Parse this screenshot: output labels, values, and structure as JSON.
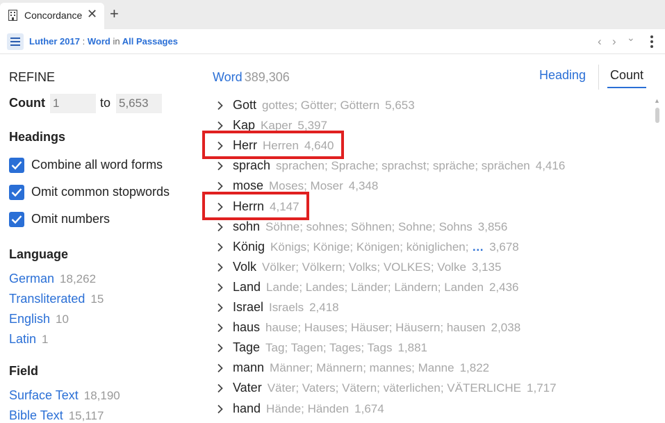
{
  "tab": {
    "title": "Concordance",
    "close_glyph": "✕",
    "add_glyph": "+",
    "icon": "building-icon"
  },
  "toolbar": {
    "resource": "Luther 2017",
    "separator": ":",
    "field": "Word",
    "in_word": "in",
    "scope": "All Passages",
    "nav_back": "‹",
    "nav_forward": "›",
    "nav_dropdown": "⌄"
  },
  "refine": {
    "title": "REFINE",
    "count_label": "Count",
    "count_min_placeholder": "1",
    "count_to": "to",
    "count_max_placeholder": "5,653"
  },
  "headings": {
    "title": "Headings",
    "options": [
      {
        "label": "Combine all word forms",
        "checked": true
      },
      {
        "label": "Omit common stopwords",
        "checked": true
      },
      {
        "label": "Omit numbers",
        "checked": true
      }
    ]
  },
  "language": {
    "title": "Language",
    "items": [
      {
        "name": "German",
        "count": "18,262"
      },
      {
        "name": "Transliterated",
        "count": "15"
      },
      {
        "name": "English",
        "count": "10"
      },
      {
        "name": "Latin",
        "count": "1"
      }
    ]
  },
  "field": {
    "title": "Field",
    "items": [
      {
        "name": "Surface Text",
        "count": "18,190"
      },
      {
        "name": "Bible Text",
        "count": "15,117"
      }
    ]
  },
  "results": {
    "label": "Word",
    "total": "389,306",
    "view_tabs": {
      "heading": "Heading",
      "count": "Count",
      "active": "count"
    },
    "rows": [
      {
        "word": "Gott",
        "forms": "gottes; Götter; Göttern",
        "more": "",
        "count": "5,653",
        "highlighted": false
      },
      {
        "word": "Kap",
        "forms": "Kaper",
        "more": "",
        "count": "5,397",
        "highlighted": false
      },
      {
        "word": "Herr",
        "forms": "Herren",
        "more": "",
        "count": "4,640",
        "highlighted": true
      },
      {
        "word": "sprach",
        "forms": "sprachen; Sprache; sprachst; spräche; sprächen",
        "more": "",
        "count": "4,416",
        "highlighted": false
      },
      {
        "word": "mose",
        "forms": "Moses; Moser",
        "more": "",
        "count": "4,348",
        "highlighted": false
      },
      {
        "word": "Herrn",
        "forms": "",
        "more": "",
        "count": "4,147",
        "highlighted": true
      },
      {
        "word": "sohn",
        "forms": "Söhne; sohnes; Söhnen; Sohne; Sohns",
        "more": "",
        "count": "3,856",
        "highlighted": false
      },
      {
        "word": "König",
        "forms": "Königs; Könige; Königen; königlichen;",
        "more": "…",
        "count": "3,678",
        "highlighted": false
      },
      {
        "word": "Volk",
        "forms": "Völker; Völkern; Volks; VOLKES; Volke",
        "more": "",
        "count": "3,135",
        "highlighted": false
      },
      {
        "word": "Land",
        "forms": "Lande; Landes; Länder; Ländern; Landen",
        "more": "",
        "count": "2,436",
        "highlighted": false
      },
      {
        "word": "Israel",
        "forms": "Israels",
        "more": "",
        "count": "2,418",
        "highlighted": false
      },
      {
        "word": "haus",
        "forms": "hause; Hauses; Häuser; Häusern; hausen",
        "more": "",
        "count": "2,038",
        "highlighted": false
      },
      {
        "word": "Tage",
        "forms": "Tag; Tagen; Tages; Tags",
        "more": "",
        "count": "1,881",
        "highlighted": false
      },
      {
        "word": "mann",
        "forms": "Männer; Männern; mannes; Manne",
        "more": "",
        "count": "1,822",
        "highlighted": false
      },
      {
        "word": "Vater",
        "forms": "Väter; Vaters; Vätern; väterlichen; VÄTERLICHE",
        "more": "",
        "count": "1,717",
        "highlighted": false
      },
      {
        "word": "hand",
        "forms": "Hände; Händen",
        "more": "",
        "count": "1,674",
        "highlighted": false
      }
    ]
  },
  "colors": {
    "accent": "#2a6fd6",
    "highlight_box": "#e02020",
    "muted": "#a8a8a8"
  }
}
